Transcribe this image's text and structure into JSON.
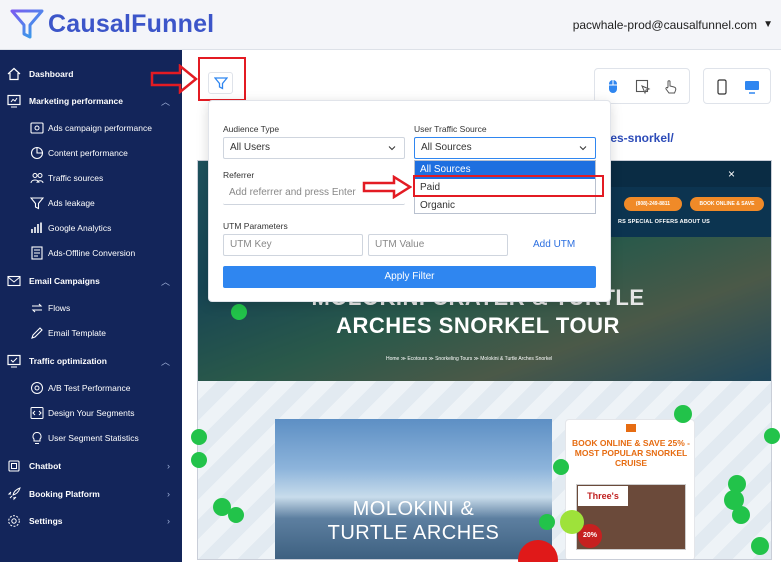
{
  "header": {
    "brand": "CausalFunnel",
    "user_email": "pacwhale-prod@causalfunnel.com",
    "user_caret": "▼",
    "brand_color": "#3c55c9"
  },
  "sidebar": {
    "items": [
      {
        "label": "Dashboard"
      },
      {
        "label": "Marketing performance"
      },
      {
        "label": "Ads campaign performance"
      },
      {
        "label": "Content performance"
      },
      {
        "label": "Traffic sources"
      },
      {
        "label": "Ads leakage"
      },
      {
        "label": "Google Analytics"
      },
      {
        "label": "Ads-Offline Conversion"
      },
      {
        "label": "Email Campaigns"
      },
      {
        "label": "Flows"
      },
      {
        "label": "Email Template"
      },
      {
        "label": "Traffic optimization"
      },
      {
        "label": "A/B Test Performance"
      },
      {
        "label": "Design Your Segments"
      },
      {
        "label": "User Segment Statistics"
      },
      {
        "label": "Chatbot"
      },
      {
        "label": "Booking Platform"
      },
      {
        "label": "Settings"
      }
    ],
    "bg_color": "#13255a"
  },
  "main": {
    "url_fragment": "hes-snorkel/"
  },
  "filter": {
    "audience_label": "Audience Type",
    "audience_value": "All Users",
    "traffic_label": "User Traffic Source",
    "traffic_value": "All Sources",
    "traffic_options": [
      "All Sources",
      "Paid",
      "Organic"
    ],
    "referrer_label": "Referrer",
    "referrer_placeholder": "Add referrer and press Enter",
    "utm_label": "UTM Parameters",
    "utm_key_placeholder": "UTM Key",
    "utm_value_placeholder": "UTM Value",
    "add_utm": "Add UTM",
    "apply": "Apply Filter",
    "apply_color": "#2f86f0",
    "highlight_color": "#e31b23"
  },
  "preview": {
    "close": "×",
    "pill_phone": "(808)-249-8811",
    "pill_book": "BOOK ONLINE & SAVE",
    "nav_links": "RS   SPECIAL OFFERS   ABOUT US",
    "hero_line1": "MOLOKINI CRATER & TURTLE",
    "hero_line2": "ARCHES SNORKEL TOUR",
    "breadcrumb": "Home  ≫  Ecotours  ≫  Snorkeling Tours  ≫  Molokini & Turtle Arches Snorkel",
    "card_title_1": "MOLOKINI &",
    "card_title_2": "TURTLE ARCHES",
    "promo_title": "BOOK ONLINE & SAVE 25% - MOST POPULAR SNORKEL CRUISE",
    "promo_logo": "Three's",
    "promo_off": "20% OFF"
  }
}
